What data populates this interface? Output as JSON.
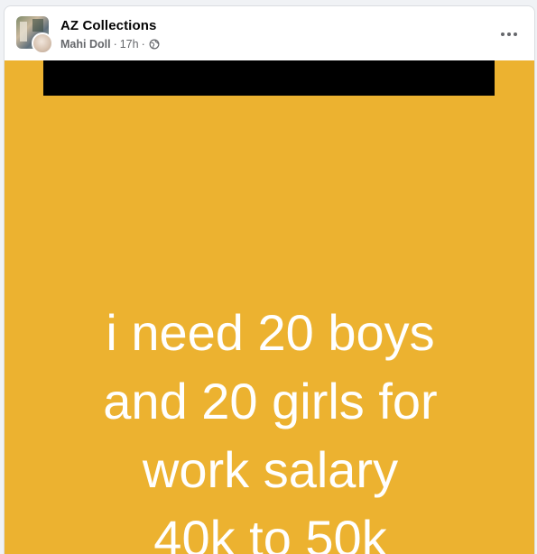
{
  "post": {
    "page_name": "AZ Collections",
    "author": "Mahi Doll",
    "separator": "·",
    "time": "17h",
    "audience_icon": "globe-icon",
    "more_icon": "more-options-icon",
    "background_color": "#ecb230",
    "text_color": "#ffffff",
    "text_lines": [
      "i need 20 boys",
      "and 20 girls for",
      "work salary",
      "40k to 50k"
    ]
  }
}
